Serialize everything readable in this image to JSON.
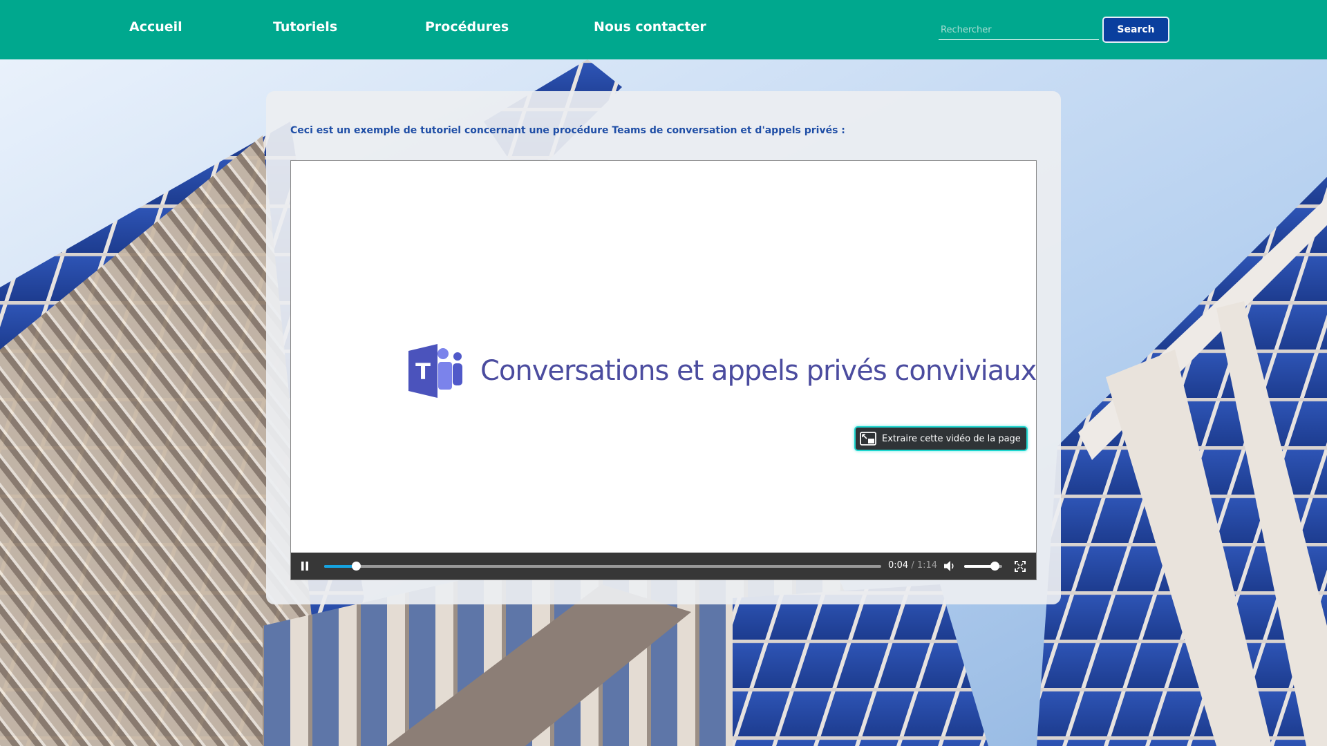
{
  "nav": {
    "links": [
      {
        "label": "Accueil"
      },
      {
        "label": "Tutoriels"
      },
      {
        "label": "Procédures"
      },
      {
        "label": "Nous contacter"
      }
    ]
  },
  "search": {
    "placeholder": "Rechercher",
    "value": "",
    "button_label": "Search"
  },
  "content": {
    "intro_text": "Ceci est un exemple de tutoriel concernant une procédure Teams de conversation et d'appels privés :"
  },
  "video": {
    "slide_logo": "microsoft-teams-logo",
    "slide_title": "Conversations et appels privés conviviaux",
    "pip_button_label": "Extraire cette vidéo de la page",
    "current_time": "0:04",
    "separator": "/",
    "total_time": "1:14",
    "progress": 0.057,
    "volume": 0.8,
    "state": "playing",
    "icons": [
      "pause-icon",
      "volume-icon",
      "fullscreen-icon",
      "pip-icon"
    ]
  },
  "colors": {
    "nav_background": "#00a88e",
    "search_button": "#0a3f9e",
    "intro_text": "#1f4ea6",
    "slide_title": "#4b4c9f",
    "progress_fill": "#15a3e0",
    "pip_border": "#1ed6cf"
  }
}
